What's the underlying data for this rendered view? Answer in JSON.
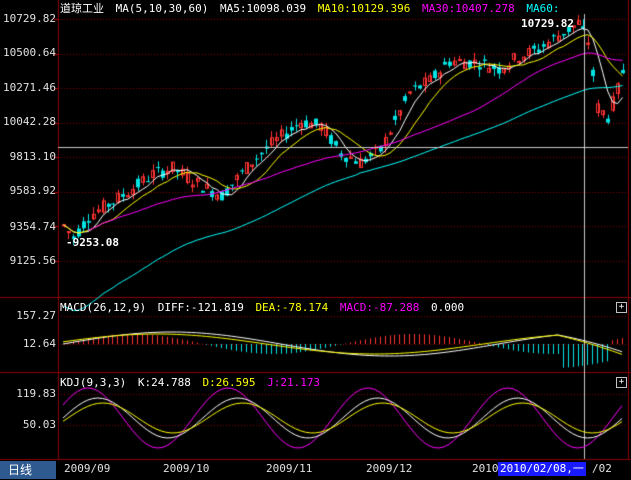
{
  "main": {
    "instrument": "道琼工业",
    "ma_label": "MA(5,10,30,60)",
    "ma5": "MA5:10098.039",
    "ma10": "MA10:10129.396",
    "ma30": "MA30:10407.278",
    "ma60": "MA60:",
    "y_ticks": [
      "10729.82",
      "10500.64",
      "10271.46",
      "10042.28",
      "9813.10",
      "9583.92",
      "9354.74",
      "9125.56"
    ],
    "high_annotation": "10729.82",
    "low_annotation": "9253.08",
    "crosshair_price": 9880
  },
  "macd": {
    "label": "MACD(26,12,9)",
    "diff": "DIFF:-121.819",
    "dea": "DEA:-78.174",
    "macd": "MACD:-87.288",
    "extra": "0.000",
    "y_ticks": [
      "157.27",
      "12.64"
    ]
  },
  "kdj": {
    "label": "KDJ(9,3,3)",
    "k": "K:24.788",
    "d": "D:26.595",
    "j": "J:21.173",
    "y_ticks": [
      "119.83",
      "50.03"
    ]
  },
  "x_axis": {
    "labels": [
      "2009/09",
      "2009/10",
      "2009/11",
      "2009/12",
      "2010",
      "2010/02"
    ],
    "crosshair_date": "2010/02/08,一"
  },
  "period_button": "日线",
  "colors": {
    "up": "#ff3232",
    "down": "#00e4e4",
    "ma5": "#ffffff",
    "ma10": "#ffff00",
    "ma30": "#ff00ff",
    "ma60": "#00ffff",
    "grid": "#8b0000",
    "k": "#ffffff",
    "d": "#ffff00",
    "j": "#ff00ff"
  }
}
